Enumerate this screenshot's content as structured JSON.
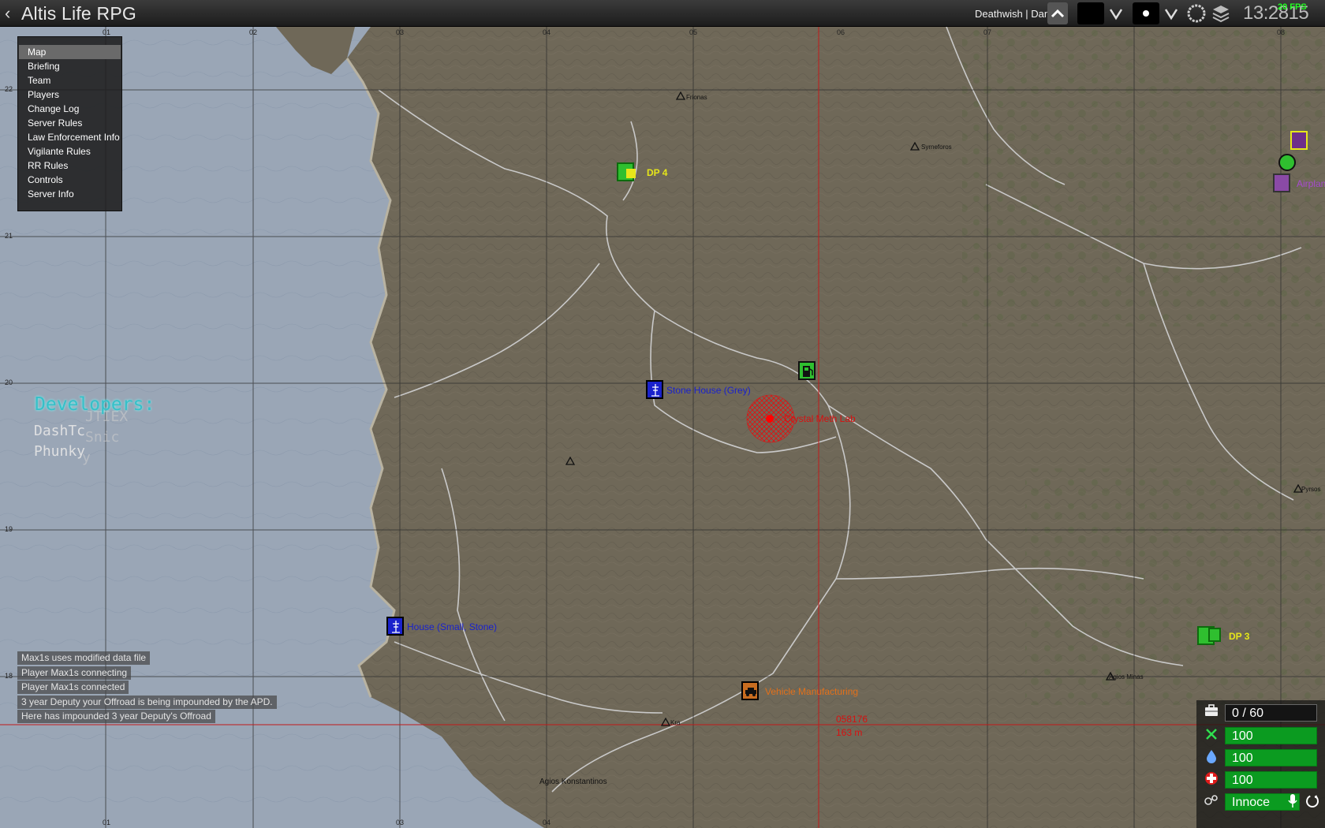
{
  "window": {
    "title": "Altis Life RPG",
    "back_glyph": "‹"
  },
  "topbar": {
    "player": "Deathwish | Danie",
    "clock": "13:2815",
    "fps": "20 FPS",
    "icons": [
      "chevron-up-icon",
      "chevron-down-icon",
      "dot-icon",
      "circle-icon",
      "layers-icon"
    ]
  },
  "menu": {
    "items": [
      "Map",
      "Briefing",
      "Team",
      "Players",
      "Change Log",
      "Server Rules",
      "Law Enforcement Info",
      "Vigilante Rules",
      "RR Rules",
      "Controls",
      "Server Info"
    ],
    "active": "Map"
  },
  "developers": {
    "title": "Developers:",
    "names": [
      "DashTc",
      "Phunky"
    ],
    "ghost": [
      "JTIEX",
      "Snic",
      "y"
    ]
  },
  "chat": [
    "Max1s uses modified data file",
    "Player Max1s connecting",
    "Player Max1s connected",
    "3 year Deputy your Offroad is being impounded by the APD.",
    "Here has impounded 3 year Deputy's Offroad"
  ],
  "markers": {
    "stone_house": "Stone House (Grey)",
    "small_house": "House (Small, Stone)",
    "meth_lab": "Crystal Meth Lab",
    "vehicle_mfg": "Vehicle Manufacturing",
    "dp4": "DP 4",
    "dp3": "DP 3",
    "airplane": "Airplan",
    "grid_readout": "058176",
    "distance": "163 m"
  },
  "places": [
    "Agios Konstantinos",
    "Agios Minas",
    "Pyrsos",
    "Syrneforos",
    "Frionas",
    "Kra"
  ],
  "grid": {
    "top": [
      "01",
      "02",
      "03",
      "04",
      "05",
      "06",
      "07",
      "08"
    ],
    "left": [
      "22",
      "21",
      "20",
      "19",
      "18"
    ]
  },
  "hud": {
    "inventory": "0 / 60",
    "food": "100",
    "water": "100",
    "health": "100",
    "status": "Innoce",
    "colors": {
      "bar": "#0b9b20"
    }
  },
  "colors": {
    "menu_active": "#6a6a6a",
    "dev_title": "#36c0c8",
    "meth": "#ff0000",
    "house": "#1a22cc"
  }
}
